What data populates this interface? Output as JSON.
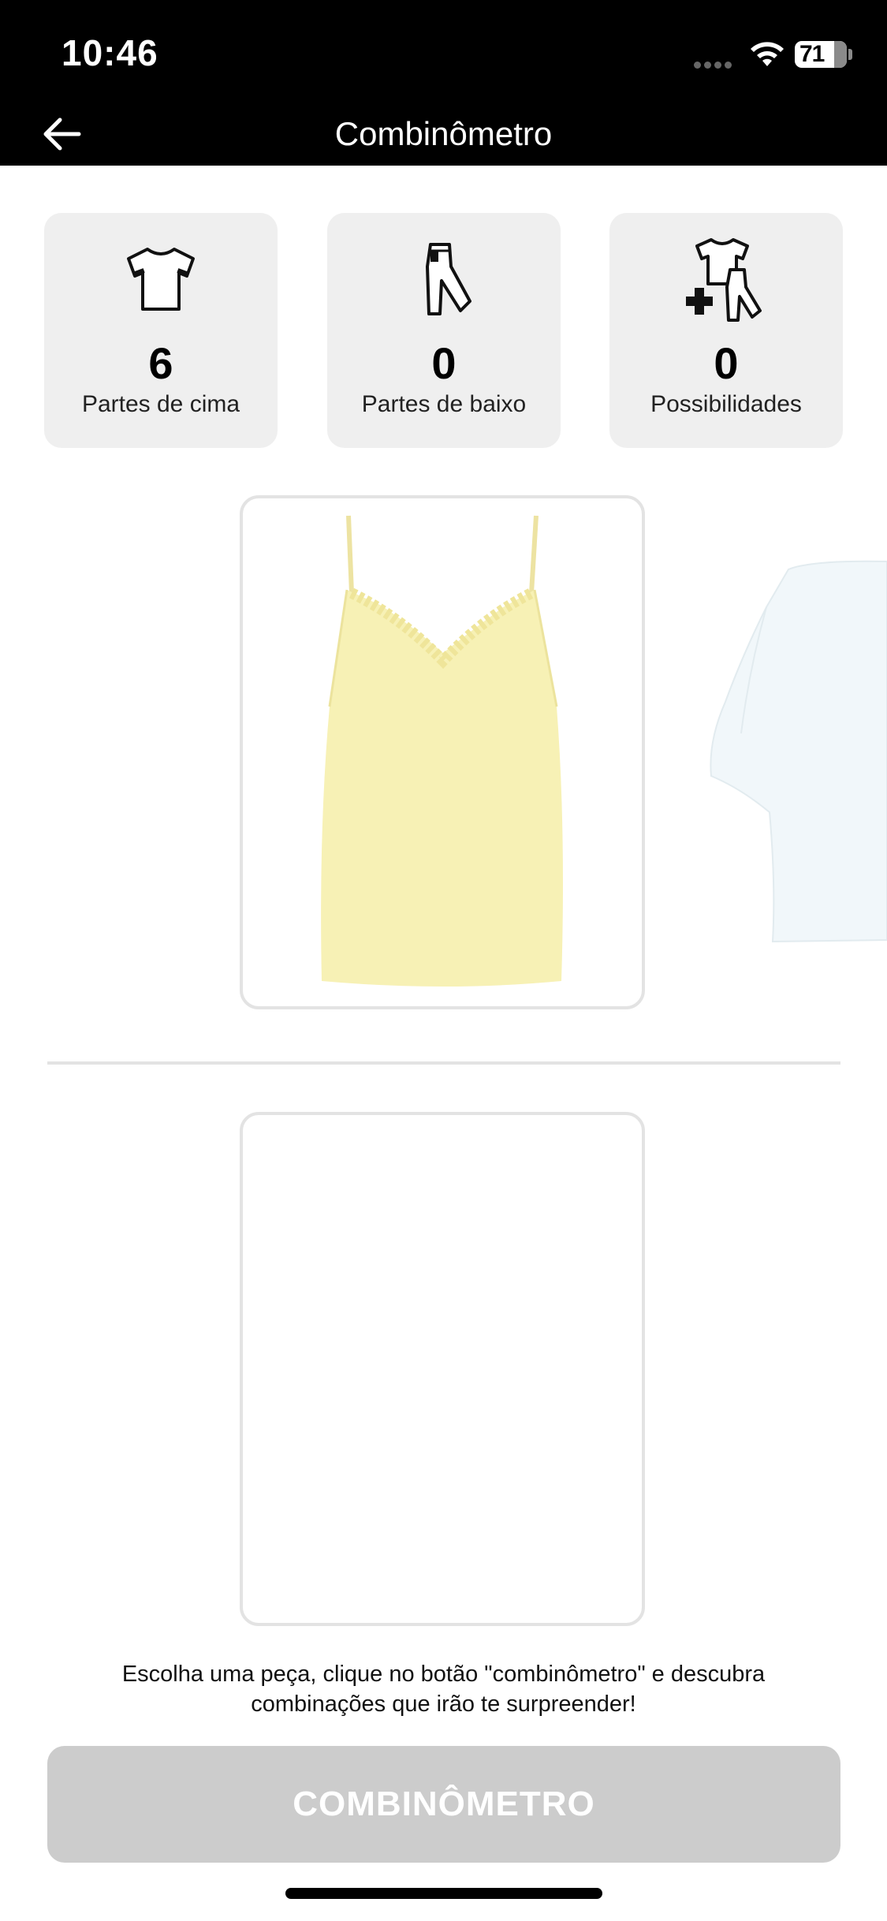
{
  "status_bar": {
    "time": "10:46",
    "battery": "71"
  },
  "nav": {
    "title": "Combinômetro"
  },
  "stats": [
    {
      "value": "6",
      "label": "Partes de cima",
      "icon": "tshirt-icon"
    },
    {
      "value": "0",
      "label": "Partes de baixo",
      "icon": "pants-icon"
    },
    {
      "value": "0",
      "label": "Possibilidades",
      "icon": "outfit-combination-icon"
    }
  ],
  "tops_carousel": {
    "selected_item_color": "#f7f1b5",
    "next_item_color": "#f1f7fa"
  },
  "hint_text": "Escolha uma peça, clique no botão \"combinômetro\" e descubra combinações que irão te surpreender!",
  "cta": {
    "label": "COMBINÔMETRO",
    "enabled": false,
    "color": "#cccccc"
  }
}
